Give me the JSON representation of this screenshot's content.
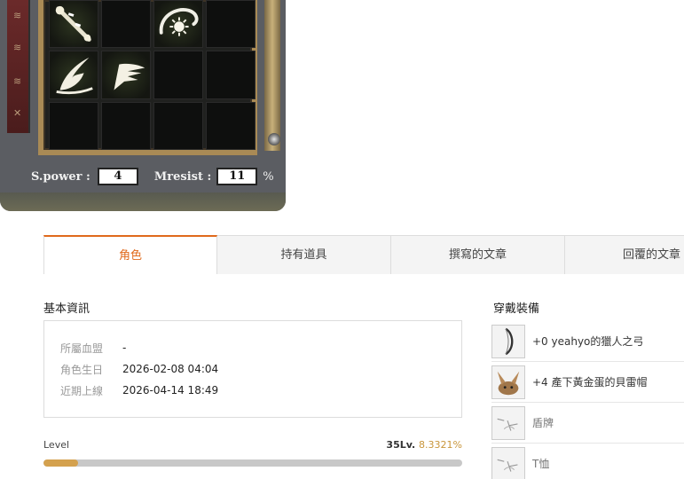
{
  "game_panel": {
    "stats": {
      "spower_label": "S.power :",
      "spower_value": "4",
      "mresist_label": "Mresist :",
      "mresist_value": "11",
      "mresist_unit": "%"
    },
    "slots": [
      {
        "icon": "wand-icon"
      },
      {
        "icon": ""
      },
      {
        "icon": "sun-charm-icon"
      },
      {
        "icon": ""
      },
      {
        "icon": "feather-icon"
      },
      {
        "icon": "wing-icon"
      },
      {
        "icon": ""
      },
      {
        "icon": ""
      },
      {
        "icon": ""
      },
      {
        "icon": ""
      },
      {
        "icon": ""
      },
      {
        "icon": ""
      }
    ]
  },
  "tabs": [
    {
      "label": "角色",
      "active": true
    },
    {
      "label": "持有道具",
      "active": false
    },
    {
      "label": "撰寫的文章",
      "active": false
    },
    {
      "label": "回覆的文章",
      "active": false
    }
  ],
  "basic_info": {
    "title": "基本資訊",
    "rows": [
      {
        "key": "所屬血盟",
        "value": "-"
      },
      {
        "key": "角色生日",
        "value": "2026-02-08 04:04"
      },
      {
        "key": "近期上線",
        "value": "2026-04-14 18:49"
      }
    ]
  },
  "level": {
    "label": "Level",
    "value": "35Lv.",
    "percent_text": "8.3321%",
    "percent": 8.3321
  },
  "equipment": {
    "title": "穿戴裝備",
    "items": [
      {
        "name": "+0 yeahyo的獵人之弓",
        "icon": "bow-icon",
        "empty": false
      },
      {
        "name": "+4 產下黃金蛋的貝雷帽",
        "icon": "rabbit-hat-icon",
        "empty": false
      },
      {
        "name": "盾牌",
        "icon": "empty-slot-icon",
        "empty": true
      },
      {
        "name": "T恤",
        "icon": "empty-slot-icon",
        "empty": true
      }
    ]
  },
  "colors": {
    "accent": "#e06a1c",
    "level_fill": "#d4a14e"
  }
}
